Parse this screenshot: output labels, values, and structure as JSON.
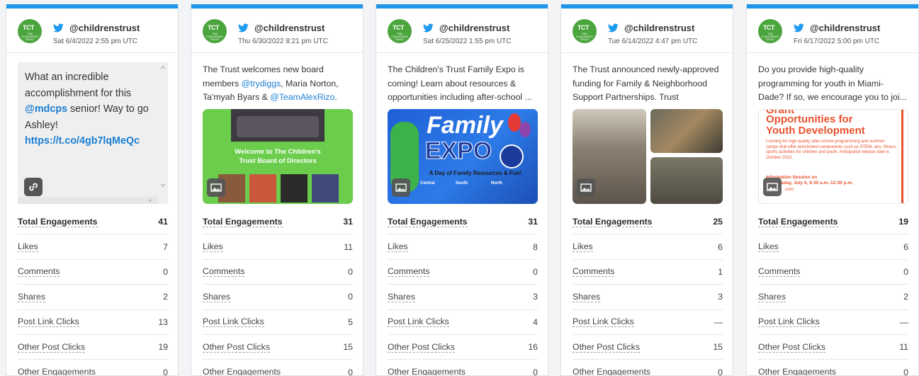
{
  "cards": [
    {
      "handle": "@childrenstrust",
      "date": "Sat 6/4/2022 2:55 pm UTC",
      "text_parts": [
        "What an incredible accomplishment for this ",
        "@mdcps",
        " senior! Way to go Ashley! ",
        "https://t.co/4gb7lqMeQc"
      ],
      "metrics": [
        {
          "label": "Total Engagements",
          "value": "41"
        },
        {
          "label": "Likes",
          "value": "7"
        },
        {
          "label": "Comments",
          "value": "0"
        },
        {
          "label": "Shares",
          "value": "2"
        },
        {
          "label": "Post Link Clicks",
          "value": "13"
        },
        {
          "label": "Other Post Clicks",
          "value": "19"
        },
        {
          "label": "Other Engagements",
          "value": "0"
        }
      ]
    },
    {
      "handle": "@childrenstrust",
      "date": "Thu 6/30/2022 8:21 pm UTC",
      "text_parts": [
        "The Trust welcomes new board members ",
        "@trydiggs",
        ", Maria Norton, Ta'myah Byars & ",
        "@TeamAlexRizo",
        ". W..."
      ],
      "image_text": [
        "Welcome to The Children's",
        "Trust Board of Directors"
      ],
      "metrics": [
        {
          "label": "Total Engagements",
          "value": "31"
        },
        {
          "label": "Likes",
          "value": "11"
        },
        {
          "label": "Comments",
          "value": "0"
        },
        {
          "label": "Shares",
          "value": "0"
        },
        {
          "label": "Post Link Clicks",
          "value": "5"
        },
        {
          "label": "Other Post Clicks",
          "value": "15"
        },
        {
          "label": "Other Engagements",
          "value": "0"
        }
      ]
    },
    {
      "handle": "@childrenstrust",
      "date": "Sat 6/25/2022 1:55 pm UTC",
      "text": "The Children's Trust Family Expo is coming! Learn about resources & opportunities including after-school ...",
      "image_text": [
        "Family",
        "EXPO",
        "A Day of Family Resources & Fun!",
        "Central",
        "South",
        "North"
      ],
      "metrics": [
        {
          "label": "Total Engagements",
          "value": "31"
        },
        {
          "label": "Likes",
          "value": "8"
        },
        {
          "label": "Comments",
          "value": "0"
        },
        {
          "label": "Shares",
          "value": "3"
        },
        {
          "label": "Post Link Clicks",
          "value": "4"
        },
        {
          "label": "Other Post Clicks",
          "value": "16"
        },
        {
          "label": "Other Engagements",
          "value": "0"
        }
      ]
    },
    {
      "handle": "@childrenstrust",
      "date": "Tue 6/14/2022 4:47 pm UTC",
      "text": "The Trust announced newly-approved funding for Family & Neighborhood Support Partnerships. Trust President...",
      "metrics": [
        {
          "label": "Total Engagements",
          "value": "25"
        },
        {
          "label": "Likes",
          "value": "6"
        },
        {
          "label": "Comments",
          "value": "1"
        },
        {
          "label": "Shares",
          "value": "3"
        },
        {
          "label": "Post Link Clicks",
          "value": "—"
        },
        {
          "label": "Other Post Clicks",
          "value": "15"
        },
        {
          "label": "Other Engagements",
          "value": "0"
        }
      ]
    },
    {
      "handle": "@childrenstrust",
      "date": "Fri 6/17/2022 5:00 pm UTC",
      "text": "Do you provide high-quality programming for youth in Miami-Dade? If so, we encourage you to joi...",
      "image_text": [
        "Grant",
        "Opportunities for",
        "Youth Development",
        "Funding for high-quality after-school programming and summer camps that offer enrichment components such as STEM, arts, fitness, sports activities for children and youth. Anticipated release date is October 2022.",
        "Information Session on",
        "Wednesday, July 6, 9:30 a.m.-12:30 p.m.",
        ".com"
      ],
      "metrics": [
        {
          "label": "Total Engagements",
          "value": "19"
        },
        {
          "label": "Likes",
          "value": "6"
        },
        {
          "label": "Comments",
          "value": "0"
        },
        {
          "label": "Shares",
          "value": "2"
        },
        {
          "label": "Post Link Clicks",
          "value": "—"
        },
        {
          "label": "Other Post Clicks",
          "value": "11"
        },
        {
          "label": "Other Engagements",
          "value": "0"
        }
      ]
    }
  ],
  "colors": {
    "accent": "#2196e8",
    "brand_green": "#4aa53c",
    "mention": "#1a7fd4",
    "twitter": "#1d9bf0"
  },
  "icons": [
    "twitter-bird-icon",
    "link-icon",
    "image-icon"
  ],
  "avatar_text": {
    "mark": "TCT",
    "caption": "THE CHILDREN'S TRUST"
  }
}
